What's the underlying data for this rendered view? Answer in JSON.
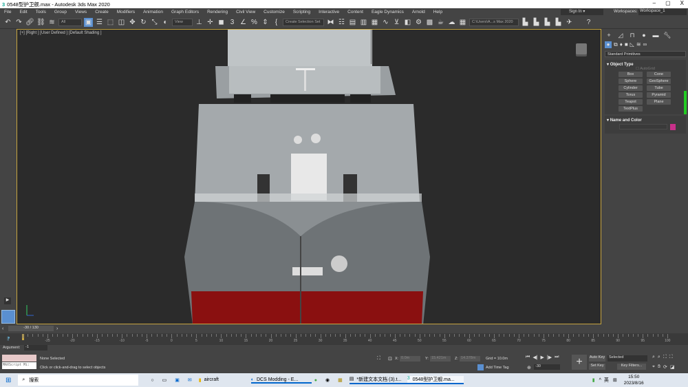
{
  "window": {
    "title": "0548型护卫舰.max - Autodesk 3ds Max 2020",
    "minimize": "–",
    "maximize": "▢",
    "close": "X"
  },
  "menu": [
    "File",
    "Edit",
    "Tools",
    "Group",
    "Views",
    "Create",
    "Modifiers",
    "Animation",
    "Graph Editors",
    "Rendering",
    "Civil View",
    "Customize",
    "Scripting",
    "Interactive",
    "Content",
    "Eagle Dynamics",
    "Arnold",
    "Help"
  ],
  "account": {
    "sign_in": "Sign In",
    "workspaces_label": "Workspaces:",
    "workspace": "Workspace_1"
  },
  "toolbar": {
    "filter": "All",
    "ref_coord": "View",
    "selection_set": "Create Selection Set",
    "path": "C:\\Users\\A...s Max 2020"
  },
  "viewport": {
    "label": "[+] [Right ] [User Defined ] [Default Shading ]"
  },
  "command_panel": {
    "category": "Standard Primitives",
    "object_type_title": "Object Type",
    "autogrid": "AutoGrid",
    "buttons": [
      "Box",
      "Cone",
      "Sphere",
      "GeoSphere",
      "Cylinder",
      "Tube",
      "Torus",
      "Pyramid",
      "Teapot",
      "Plane",
      "TextPlus"
    ],
    "name_color_title": "Name and Color",
    "object_color": "#c8308a"
  },
  "timeline": {
    "frame": "-30 / 130",
    "ticks": [
      "-25",
      "-20",
      "-15",
      "-10",
      "-5",
      "0",
      "5",
      "10",
      "15",
      "20",
      "25",
      "30",
      "35",
      "40",
      "45",
      "50",
      "55",
      "60",
      "65",
      "70",
      "75",
      "80",
      "85",
      "90",
      "95",
      "100"
    ]
  },
  "status": {
    "argument_label": "Argument:",
    "argument_value": "-1",
    "maxscript": "MAXScript Mi:",
    "selection": "None Selected",
    "prompt": "Click or click-and-drag to select objects",
    "x_label": "X:",
    "x": "0.0m",
    "y_label": "Y:",
    "y": "15.421m",
    "z_label": "Z:",
    "z": "14.378m",
    "grid": "Grid = 10.0m",
    "add_time_tag": "Add Time Tag",
    "auto_key": "Auto Key",
    "set_key": "Set Key",
    "key_mode": "Selected",
    "key_filters": "Key Filters...",
    "current_frame": "-30"
  },
  "taskbar": {
    "search": "搜索",
    "apps": [
      "aircraft",
      "DCS Modding - E...",
      "*新建文本文档 (3).t...",
      "0548型护卫舰.ma..."
    ],
    "ime": "英",
    "time": "15:50",
    "date": "2023/8/16"
  }
}
